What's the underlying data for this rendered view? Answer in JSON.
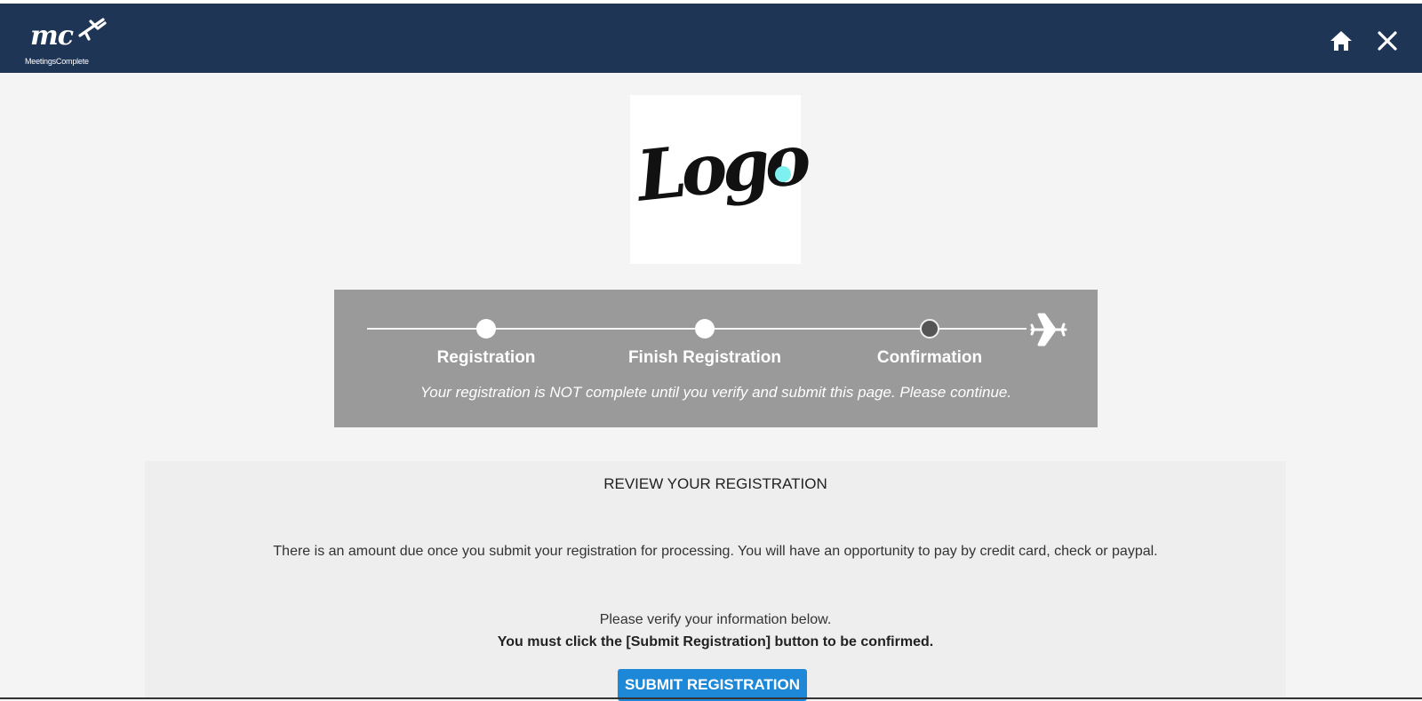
{
  "header": {
    "brand_mark": "mc",
    "brand_name": "MeetingsComplete",
    "icons": {
      "home": "home-icon",
      "close": "close-icon"
    },
    "background_color": "#1f3556"
  },
  "logo": {
    "text": "Logo",
    "dot_color": "#7ef0ef"
  },
  "progress": {
    "steps": [
      {
        "label": "Registration",
        "state": "completed"
      },
      {
        "label": "Finish Registration",
        "state": "completed"
      },
      {
        "label": "Confirmation",
        "state": "current"
      }
    ],
    "end_icon": "airplane-icon",
    "note": "Your registration is NOT complete until you verify and submit this page. Please continue."
  },
  "review": {
    "title": "REVIEW YOUR REGISTRATION",
    "amount_note": "There is an amount due once you submit your registration for processing. You will have an opportunity to pay by credit card, check or paypal.",
    "verify_note": "Please verify your information below.",
    "must_note": "You must click the [Submit Registration] button to be confirmed.",
    "submit_label": "SUBMIT REGISTRATION",
    "submit_color": "#1e88d8"
  }
}
